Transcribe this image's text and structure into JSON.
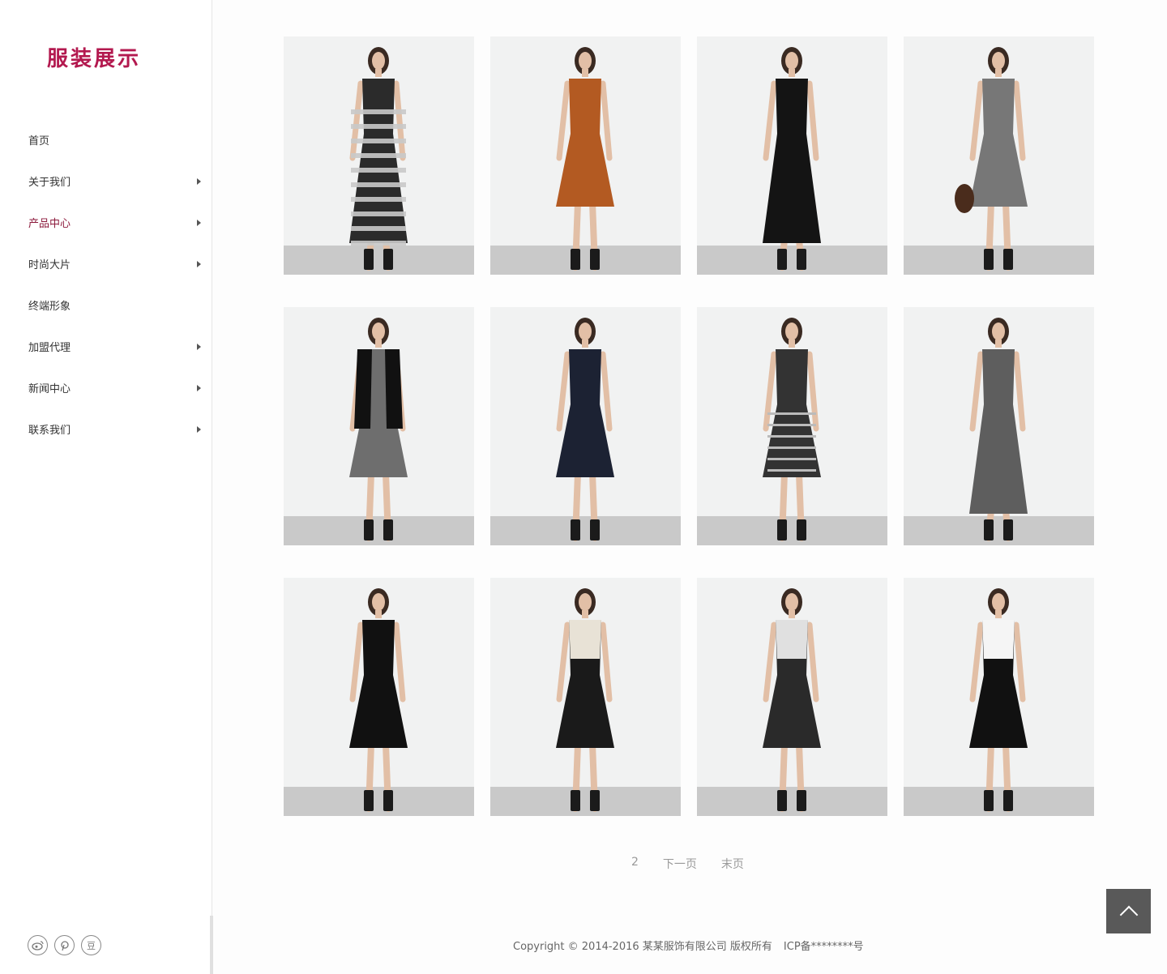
{
  "logo": {
    "text": "服装展示"
  },
  "nav": {
    "items": [
      {
        "label": "首页",
        "has_submenu": false
      },
      {
        "label": "关于我们",
        "has_submenu": true
      },
      {
        "label": "产品中心",
        "has_submenu": true,
        "active": true
      },
      {
        "label": "时尚大片",
        "has_submenu": true
      },
      {
        "label": "终端形象",
        "has_submenu": false
      },
      {
        "label": "加盟代理",
        "has_submenu": true
      },
      {
        "label": "新闻中心",
        "has_submenu": true
      },
      {
        "label": "联系我们",
        "has_submenu": true
      }
    ]
  },
  "social": {
    "icons": [
      {
        "name": "weibo-icon"
      },
      {
        "name": "pinterest-icon"
      },
      {
        "name": "douban-icon",
        "glyph": "豆"
      }
    ]
  },
  "products": [
    {
      "dress": "#2b2b2b",
      "accent": "#c9c9c9",
      "style": "striped-maxi"
    },
    {
      "dress": "#b35a22",
      "accent": "#8a4419",
      "style": "halter"
    },
    {
      "dress": "#141414",
      "accent": "#2a2a2a",
      "style": "lace-maxi"
    },
    {
      "dress": "#777777",
      "accent": "#444444",
      "style": "print-shift"
    },
    {
      "dress": "#6e6e6e",
      "accent": "#111111",
      "style": "jacket-tweed"
    },
    {
      "dress": "#1c2233",
      "accent": "#1c2233",
      "style": "shift"
    },
    {
      "dress": "#333333",
      "accent": "#1a1a1a",
      "style": "check"
    },
    {
      "dress": "#5e5e5e",
      "accent": "#222222",
      "style": "sheer-long"
    },
    {
      "dress": "#111111",
      "accent": "#111111",
      "style": "long-sleeve"
    },
    {
      "dress": "#1a1a1a",
      "accent": "#e8e2d6",
      "style": "floral-skirt"
    },
    {
      "dress": "#2a2a2a",
      "accent": "#e0e0e0",
      "style": "patch"
    },
    {
      "dress": "#111111",
      "accent": "#f5f5f5",
      "style": "colorblock"
    }
  ],
  "pagination": {
    "current": "2",
    "next": "下一页",
    "last": "末页"
  },
  "footer": {
    "copyright": "Copyright © 2014-2016 某某服饰有限公司 版权所有",
    "icp": "ICP备********号"
  },
  "colors": {
    "brand": "#b3194f",
    "active_nav": "#8c1a3c",
    "back_top": "#595959"
  }
}
